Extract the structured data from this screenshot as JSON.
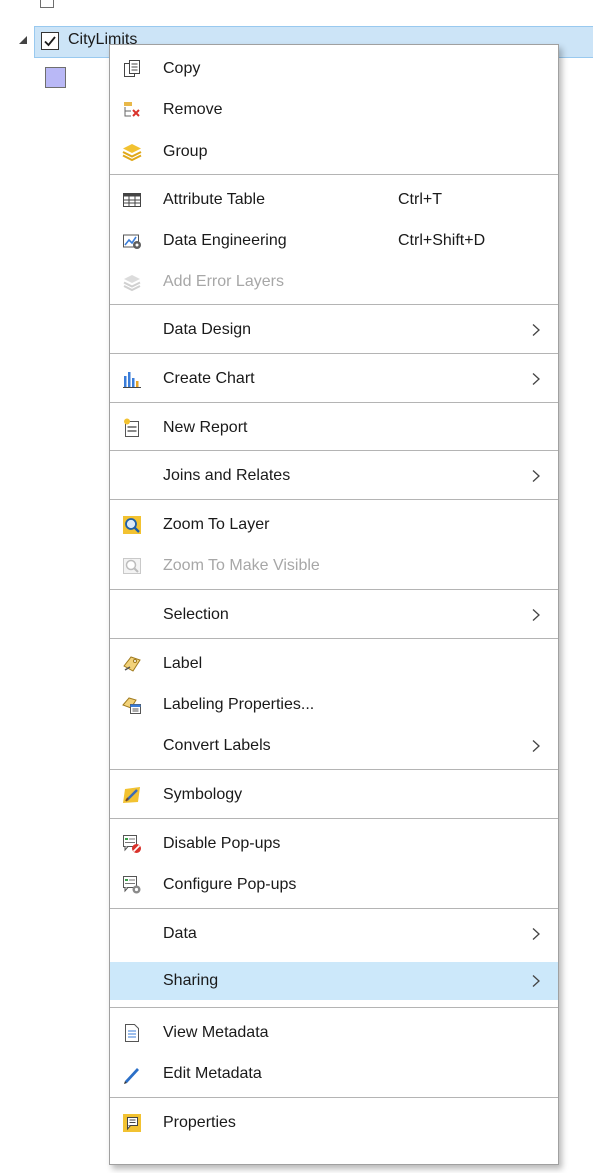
{
  "tree": {
    "layer_name": "CityLimits",
    "layer_checked": true
  },
  "menu": {
    "items": [
      {
        "label": "Copy",
        "icon": "copy-icon"
      },
      {
        "label": "Remove",
        "icon": "remove-icon"
      },
      {
        "label": "Group",
        "icon": "group-layers-icon"
      },
      {
        "label": "Attribute Table",
        "shortcut": "Ctrl+T",
        "icon": "table-icon"
      },
      {
        "label": "Data Engineering",
        "shortcut": "Ctrl+Shift+D",
        "icon": "data-engineering-icon"
      },
      {
        "label": "Add Error Layers",
        "icon": "error-layers-icon",
        "disabled": true
      },
      {
        "label": "Data Design",
        "submenu": true
      },
      {
        "label": "Create Chart",
        "icon": "chart-icon",
        "submenu": true
      },
      {
        "label": "New Report",
        "icon": "report-icon"
      },
      {
        "label": "Joins and Relates",
        "submenu": true
      },
      {
        "label": "Zoom To Layer",
        "icon": "zoom-to-layer-icon"
      },
      {
        "label": "Zoom To Make Visible",
        "icon": "zoom-visible-icon",
        "disabled": true
      },
      {
        "label": "Selection",
        "submenu": true
      },
      {
        "label": "Label",
        "icon": "label-icon"
      },
      {
        "label": "Labeling Properties...",
        "icon": "labeling-properties-icon"
      },
      {
        "label": "Convert Labels",
        "submenu": true
      },
      {
        "label": "Symbology",
        "icon": "symbology-icon"
      },
      {
        "label": "Disable Pop-ups",
        "icon": "disable-popups-icon"
      },
      {
        "label": "Configure Pop-ups",
        "icon": "configure-popups-icon"
      },
      {
        "label": "Data",
        "submenu": true
      },
      {
        "label": "Sharing",
        "submenu": true,
        "highlighted": true
      },
      {
        "label": "View Metadata",
        "icon": "view-metadata-icon"
      },
      {
        "label": "Edit Metadata",
        "icon": "edit-metadata-icon"
      },
      {
        "label": "Properties",
        "icon": "properties-icon"
      }
    ]
  },
  "colors": {
    "highlight": "#cce8fa",
    "selected_row": "#cce4f7",
    "disabled_text": "#a7a7a7",
    "swatch": "#b9b8f6"
  }
}
